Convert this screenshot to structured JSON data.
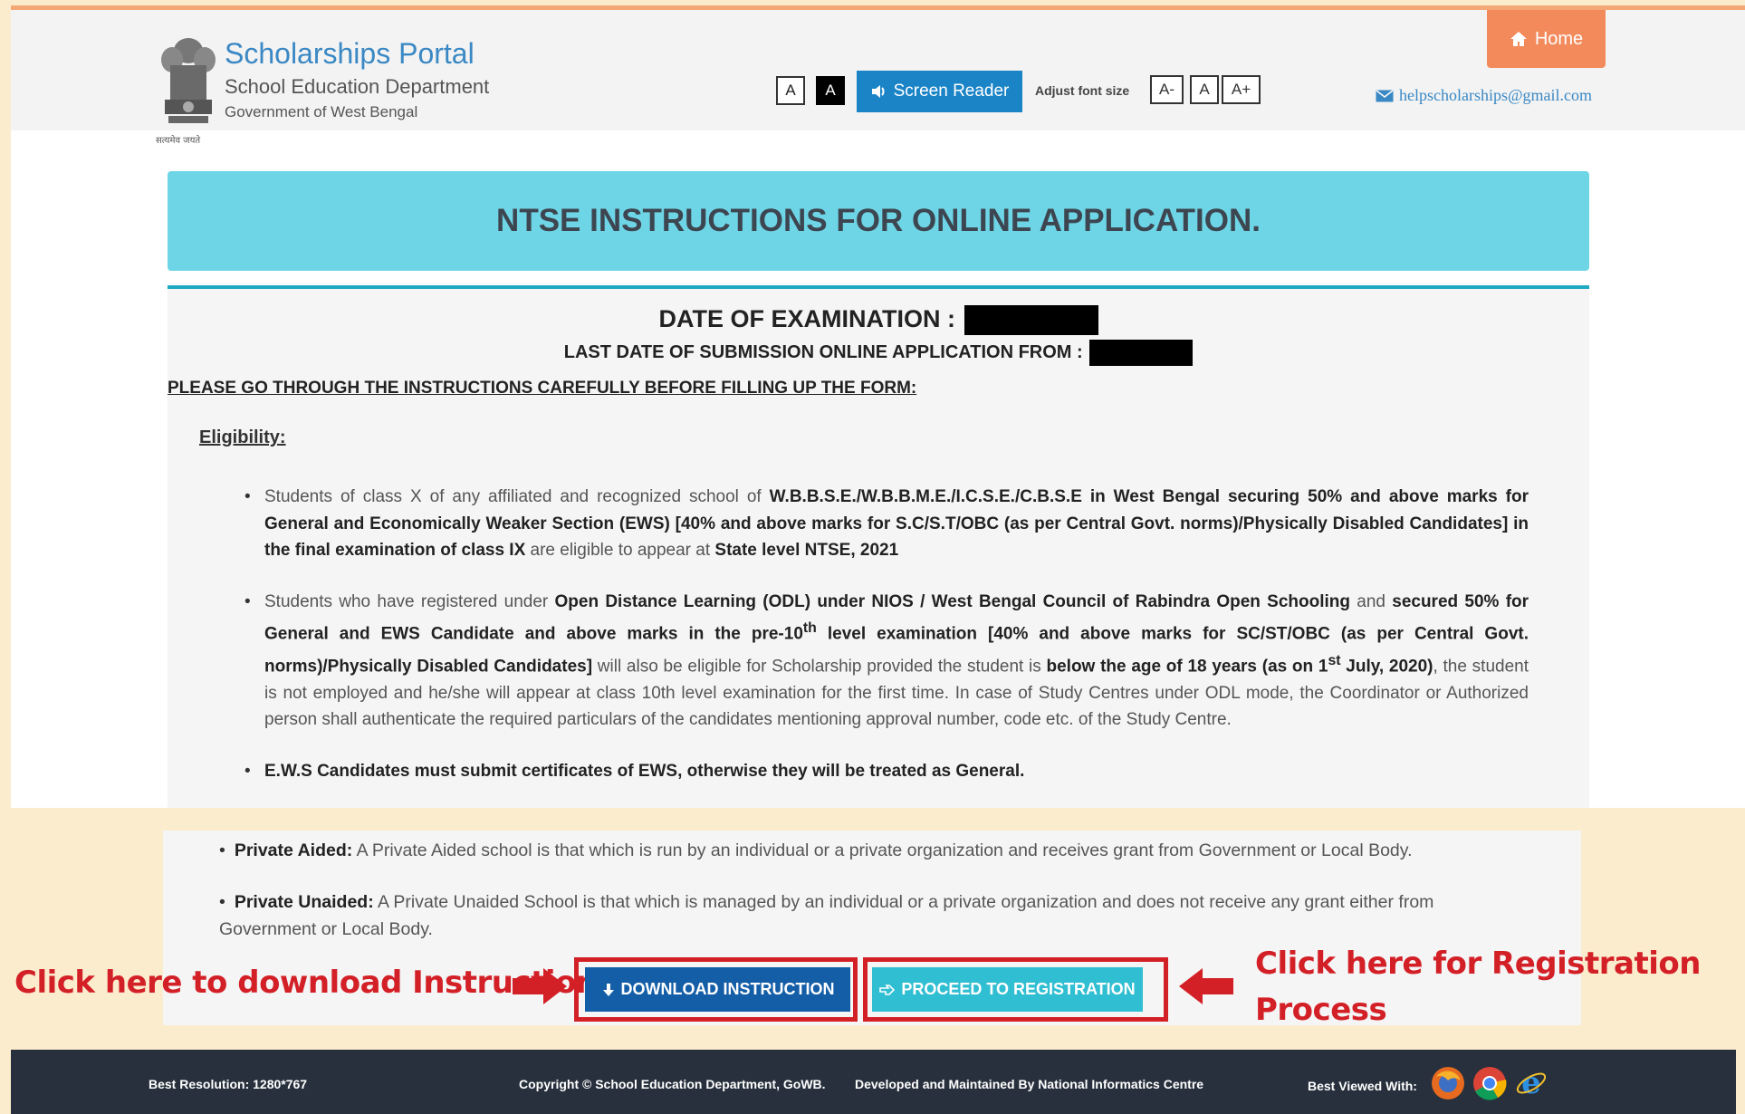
{
  "header": {
    "portal_title": "Scholarships Portal",
    "department": "School Education Department",
    "government": "Government of West Bengal",
    "emblem_caption": "सत्यमेव जयते",
    "contrast_light_label": "A",
    "contrast_dark_label": "A",
    "screen_reader_label": "Screen Reader",
    "adjust_font_label": "Adjust font size",
    "font_decrease_label": "A-",
    "font_reset_label": "A",
    "font_increase_label": "A+",
    "home_label": "Home",
    "help_email": "helpscholarships@gmail.com"
  },
  "banner": {
    "title": "NTSE INSTRUCTIONS FOR ONLINE APPLICATION."
  },
  "content": {
    "exam_date_label": "DATE OF EXAMINATION :",
    "last_date_label": "LAST DATE OF SUBMISSION ONLINE APPLICATION FROM :",
    "instructions_heading": "PLEASE GO THROUGH THE INSTRUCTIONS CAREFULLY BEFORE FILLING UP THE FORM:",
    "eligibility_heading": "Eligibility",
    "eligibility_colon": ":"
  },
  "eligibility": {
    "item1": {
      "p1": "Students of class X of any affiliated and recognized school of ",
      "b1": "W.B.B.S.E./W.B.B.M.E./I.C.S.E./C.B.S.E in West Bengal securing 50% and above marks for General and Economically Weaker Section (EWS) [40% and above marks for S.C/S.T/OBC (as per Central Govt. norms)/Physically Disabled Candidates] in the final examination of class IX",
      "p2": " are eligible to appear at ",
      "b2": "State level NTSE, 2021"
    },
    "item2": {
      "p1": "Students who have registered under ",
      "b1": "Open Distance Learning (ODL) under NIOS / West Bengal Council of Rabindra Open Schooling",
      "p2": " and ",
      "b2": "secured 50% for General and EWS Candidate and above marks in the pre-10",
      "sup1": "th",
      "b3": " level examination [40% and above marks for SC/ST/OBC (as per Central Govt. norms)/Physically Disabled Candidates]",
      "p3": " will also be eligible for Scholarship provided the student is ",
      "b4": "below the age of 18 years (as on 1",
      "sup2": "st",
      "b5": " July, 2020)",
      "p4": ", the student is not employed and he/she will appear at class 10th level examination for the first time. In case of Study Centres under ODL mode, the Coordinator or Authorized person shall authenticate the required particulars of the candidates mentioning approval number, code etc. of the Study Centre."
    },
    "item3": "E.W.S Candidates must submit certificates of EWS, otherwise they will be treated as General."
  },
  "school_types": {
    "aided_label": "Private Aided:",
    "aided_text": " A Private Aided school is that which is run by an individual or a private organization and receives grant from Government or Local Body.",
    "unaided_label": "Private Unaided:",
    "unaided_text": " A Private Unaided School is that which is managed by an individual or a private organization and does not receive any grant either from Government or Local Body."
  },
  "actions": {
    "download_label": "DOWNLOAD INSTRUCTION",
    "register_label": "PROCEED TO REGISTRATION"
  },
  "annotations": {
    "download_hint": "Click here to download Instruction",
    "register_hint": "Click here for Registration Process"
  },
  "footer": {
    "resolution": "Best Resolution: 1280*767",
    "copyright": "Copyright © School Education Department, GoWB.",
    "developed": "Developed and Maintained By National Informatics Centre",
    "best_viewed": "Best Viewed With:",
    "browsers": [
      "firefox-icon",
      "chrome-icon",
      "internet-explorer-icon"
    ]
  },
  "colors": {
    "brand_blue": "#3a88c4",
    "banner_cyan": "#6ed5e6",
    "home_orange": "#f38a5c",
    "annotation_red": "#d32027",
    "download_blue": "#145ea8",
    "register_cyan": "#30bed2",
    "footer_dark": "#27303c"
  }
}
